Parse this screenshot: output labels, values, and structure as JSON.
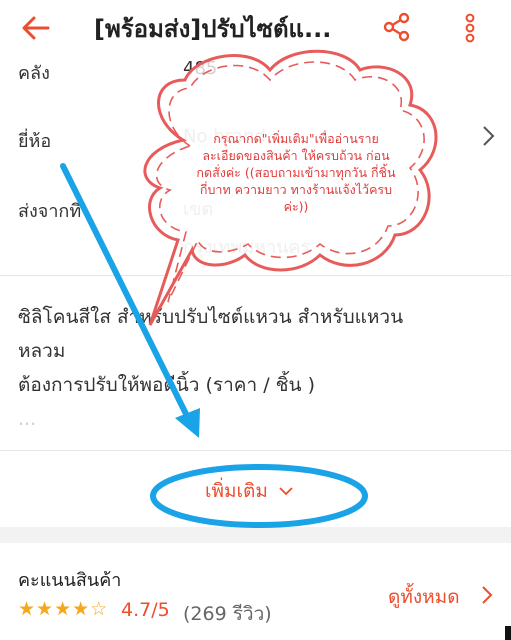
{
  "header": {
    "title": "[พร้อมส่ง]ปรับไซต์แ..."
  },
  "details": {
    "stock_label": "คลัง",
    "stock_value": "485",
    "brand_label": "ยี่ห้อ",
    "brand_value": "No brand",
    "ship_from_label": "ส่งจากที่",
    "ship_from_value_1": "เขต",
    "ship_from_value_2": "กรุงเทพมหานคร"
  },
  "description": {
    "line1": "ซิลิโคนสีใส สำหรับปรับไซต์แหวน สำหรับแหวน",
    "line2": "หลวม",
    "line3": "ต้องการปรับให้พอดีนิ้ว  (ราคา / ชิ้น )",
    "line4": "..."
  },
  "more_button": {
    "label": "เพิ่มเติม"
  },
  "annotation": {
    "bubble_text": "กรุณากด\"เพิ่มเติม\"เพื่ออ่านรายละเอียดของสินค้า ให้ครบถ้วน ก่อนกดสั่งค่ะ ((สอบถามเข้ามาทุกวัน กี่ชิ้น กี่บาท ความยาว ทางร้านแจ้งไว้ครบค่ะ))",
    "bubble_color": "#e85b5b",
    "arrow_color": "#1aa3e6",
    "ellipse_color": "#1aa3e6"
  },
  "rating": {
    "title": "คะแนนสินค้า",
    "stars": "★★★★☆",
    "score": "4.7/5",
    "count": "(269 รีวิว)",
    "see_all": "ดูทั้งหมด",
    "star_value": 4.7
  },
  "colors": {
    "accent": "#ee4d2d",
    "star": "#f4a81d"
  },
  "icons": {
    "back": "arrow-left-icon",
    "share": "share-icon",
    "more": "more-vertical-icon",
    "chevron": "chevron-right-icon",
    "chevron_down": "chevron-down-icon"
  }
}
